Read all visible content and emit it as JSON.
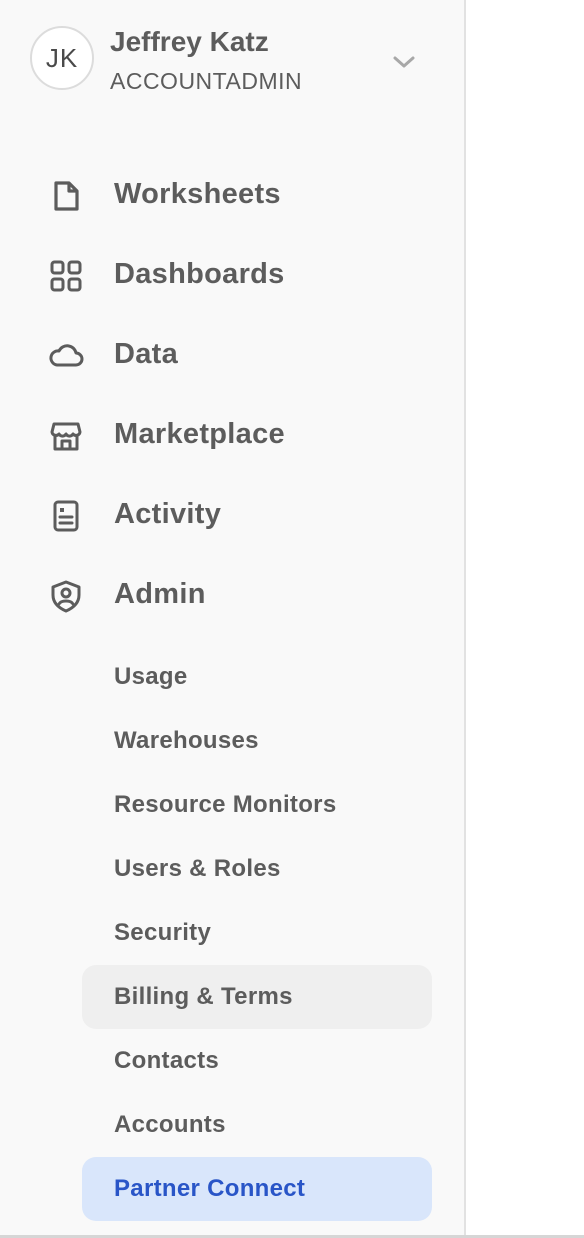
{
  "user": {
    "initials": "JK",
    "name": "Jeffrey Katz",
    "role": "ACCOUNTADMIN"
  },
  "nav": {
    "items": [
      {
        "label": "Worksheets",
        "icon": "document-icon"
      },
      {
        "label": "Dashboards",
        "icon": "grid-icon"
      },
      {
        "label": "Data",
        "icon": "cloud-icon"
      },
      {
        "label": "Marketplace",
        "icon": "storefront-icon"
      },
      {
        "label": "Activity",
        "icon": "activity-log-icon"
      },
      {
        "label": "Admin",
        "icon": "admin-shield-icon"
      }
    ],
    "admin_subitems": [
      {
        "label": "Usage"
      },
      {
        "label": "Warehouses"
      },
      {
        "label": "Resource Monitors"
      },
      {
        "label": "Users & Roles"
      },
      {
        "label": "Security"
      },
      {
        "label": "Billing & Terms"
      },
      {
        "label": "Contacts"
      },
      {
        "label": "Accounts"
      },
      {
        "label": "Partner Connect"
      }
    ],
    "hovered_subitem": "Billing & Terms",
    "active_subitem": "Partner Connect"
  },
  "colors": {
    "sidebar_bg": "#f9f9f9",
    "text": "#5c5c5c",
    "hover_bg": "#efefef",
    "active_bg": "#d9e6fb",
    "active_text": "#2955c7"
  }
}
